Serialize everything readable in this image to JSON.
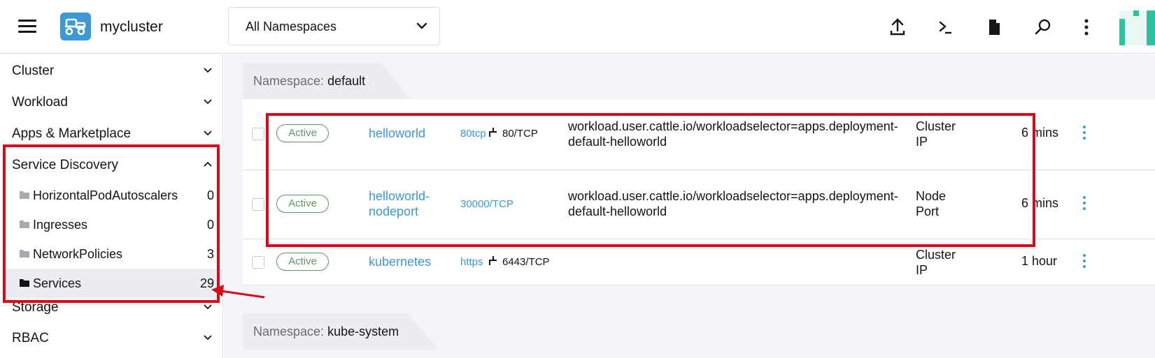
{
  "header": {
    "cluster_name": "mycluster",
    "namespace_filter": "All Namespaces",
    "icons": [
      "upload-icon",
      "terminal-icon",
      "file-icon",
      "search-icon",
      "more-vertical-icon"
    ]
  },
  "sidebar": {
    "groups": [
      {
        "label": "Cluster",
        "expanded": false
      },
      {
        "label": "Workload",
        "expanded": false
      },
      {
        "label": "Apps & Marketplace",
        "expanded": false
      },
      {
        "label": "Service Discovery",
        "expanded": true
      },
      {
        "label": "Storage",
        "expanded": false
      },
      {
        "label": "RBAC",
        "expanded": false
      }
    ],
    "service_discovery_items": [
      {
        "label": "HorizontalPodAutoscalers",
        "count": "0"
      },
      {
        "label": "Ingresses",
        "count": "0"
      },
      {
        "label": "NetworkPolicies",
        "count": "3"
      },
      {
        "label": "Services",
        "count": "29",
        "active": true
      }
    ]
  },
  "main": {
    "groups": [
      {
        "key": "Namespace:",
        "name": "default"
      },
      {
        "key": "Namespace:",
        "name": "kube-system"
      }
    ],
    "rows": [
      {
        "state": "Active",
        "name": [
          "helloworld"
        ],
        "port_link": "80tcp",
        "port_text": "80/TCP",
        "selector": [
          "workload.user.cattle.io/workloadselector=apps.deployment-",
          "default-helloworld"
        ],
        "type": [
          "Cluster",
          "IP"
        ],
        "age": "6 mins"
      },
      {
        "state": "Active",
        "name": [
          "helloworld-",
          "nodeport"
        ],
        "port_link": "30000/TCP",
        "port_text": "",
        "selector": [
          "workload.user.cattle.io/workloadselector=apps.deployment-",
          "default-helloworld"
        ],
        "type": [
          "Node",
          "Port"
        ],
        "age": "6 mins"
      },
      {
        "state": "Active",
        "name": [
          "kubernetes"
        ],
        "port_link": "https",
        "port_text": "6443/TCP",
        "selector": [
          "",
          ""
        ],
        "type": [
          "Cluster",
          "IP"
        ],
        "age": "1 hour"
      }
    ]
  },
  "colors": {
    "accent": "#3d98d3",
    "active_state": "#5d995d",
    "annotation": "#d9091c",
    "brand_green": "#2dc3a0"
  }
}
